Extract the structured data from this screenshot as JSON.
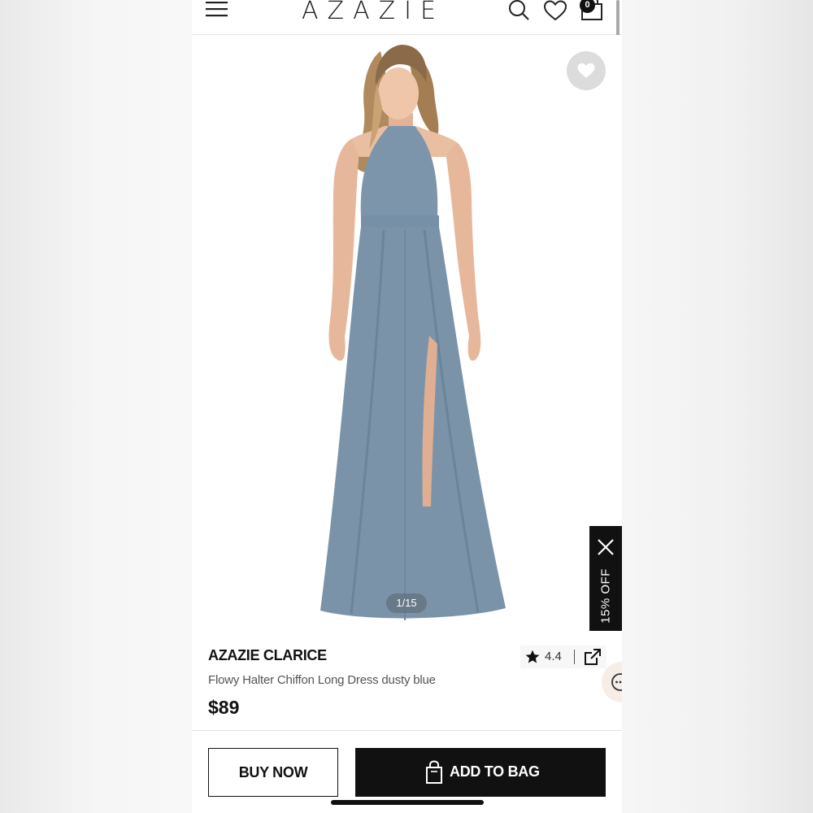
{
  "header": {
    "brand": "AZAZIE",
    "cart_count": "0",
    "icons": [
      "menu-icon",
      "search-icon",
      "heart-icon",
      "shopping-bag-icon"
    ]
  },
  "gallery": {
    "counter": "1/15",
    "dress_color": "#7b93a9",
    "wishlist_icon": "heart-icon"
  },
  "promo": {
    "label": "15% OFF",
    "close_icon": "close-icon"
  },
  "product": {
    "name": "AZAZIE CLARICE",
    "description": "Flowy Halter Chiffon Long Dress dusty blue",
    "price": "$89",
    "rating": "4.4"
  },
  "actions": {
    "buy_now": "BUY NOW",
    "add_to_bag": "ADD TO BAG"
  }
}
